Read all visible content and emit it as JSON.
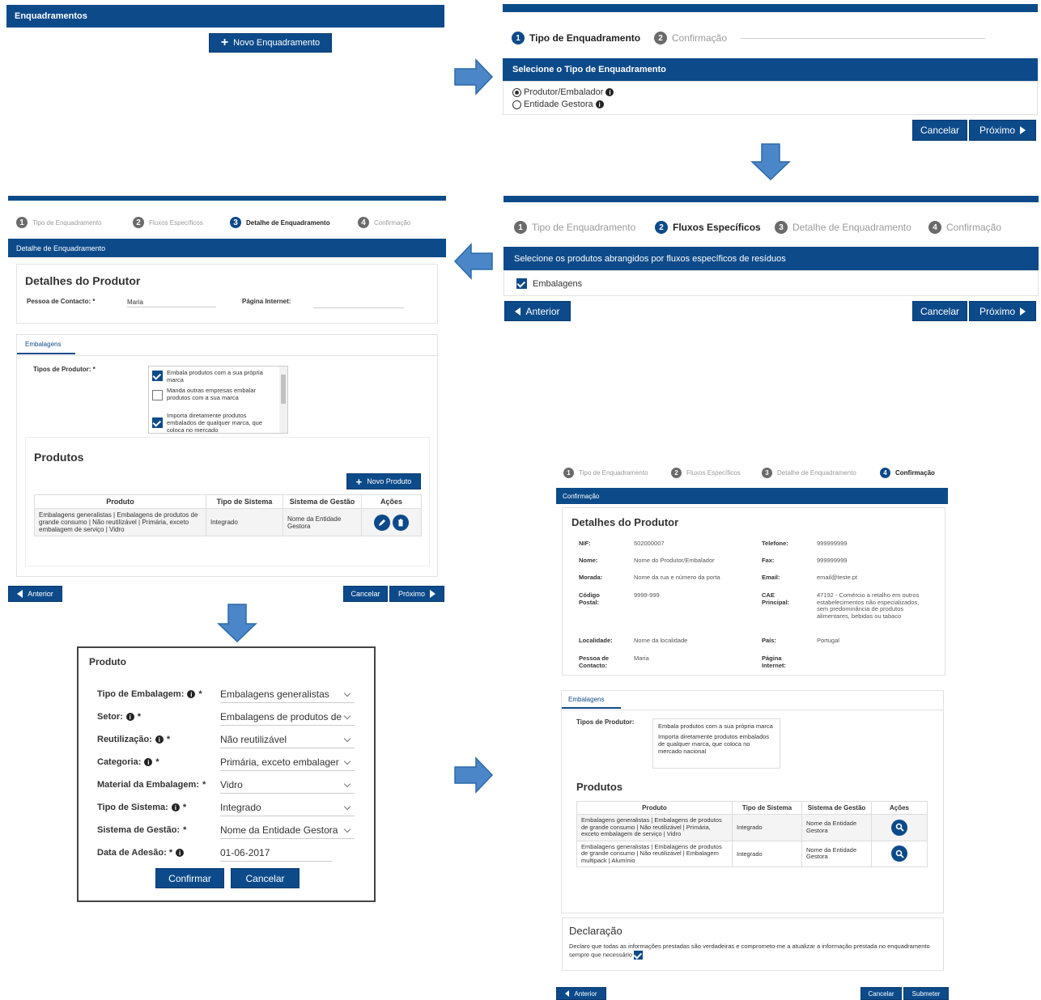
{
  "p1": {
    "header": "Enquadramentos",
    "new_btn": "Novo Enquadramento"
  },
  "p2": {
    "steps": [
      {
        "n": "1",
        "label": "Tipo de Enquadramento"
      },
      {
        "n": "2",
        "label": "Confirmação"
      }
    ],
    "section": "Selecione o Tipo de Enquadramento",
    "options": [
      "Produtor/Embalador",
      "Entidade Gestora"
    ],
    "cancel": "Cancelar",
    "next": "Próximo"
  },
  "p3": {
    "steps": [
      {
        "n": "1",
        "label": "Tipo de Enquadramento"
      },
      {
        "n": "2",
        "label": "Fluxos Específicos"
      },
      {
        "n": "3",
        "label": "Detalhe de Enquadramento"
      },
      {
        "n": "4",
        "label": "Confirmação"
      }
    ],
    "section": "Selecione os produtos abrangidos por fluxos específicos de resíduos",
    "checkbox": "Embalagens",
    "prev": "Anterior",
    "cancel": "Cancelar",
    "next": "Próximo"
  },
  "p4": {
    "steps": [
      {
        "n": "1",
        "label": "Tipo de Enquadramento"
      },
      {
        "n": "2",
        "label": "Fluxos Específicos"
      },
      {
        "n": "3",
        "label": "Detalhe de Enquadramento"
      },
      {
        "n": "4",
        "label": "Confirmação"
      }
    ],
    "section": "Detalhe de Enquadramento",
    "title": "Detalhes do Produtor",
    "contact_label": "Pessoa de Contacto: *",
    "contact_value": "Maria",
    "web_label": "Página Internet:",
    "tab": "Embalagens",
    "types_label": "Tipos de Produtor: *",
    "types": [
      {
        "text": "Embala produtos com a sua própria marca",
        "checked": true
      },
      {
        "text": "Manda outras empresas embalar produtos com a sua marca",
        "checked": false
      },
      {
        "text": "Importa diretamente produtos embalados de qualquer marca, que coloca no mercado",
        "checked": true
      }
    ],
    "products_title": "Produtos",
    "new_product": "Novo Produto",
    "table_headers": [
      "Produto",
      "Tipo de Sistema",
      "Sistema de Gestão",
      "Ações"
    ],
    "row": [
      "Embalagens generalistas | Embalagens de produtos de grande consumo | Não reutilizável | Primária, exceto embalagem de serviço | Vidro",
      "Integrado",
      "Nome da Entidade Gestora"
    ],
    "prev": "Anterior",
    "cancel": "Cancelar",
    "next": "Próximo"
  },
  "p5": {
    "title": "Produto",
    "fields": [
      {
        "label": "Tipo de Embalagem:",
        "info": true,
        "req": "*",
        "value": "Embalagens generalistas",
        "select": true
      },
      {
        "label": "Setor:",
        "info": true,
        "req": "*",
        "value": "Embalagens de produtos de",
        "select": true
      },
      {
        "label": "Reutilização:",
        "info": true,
        "req": "*",
        "value": "Não reutilizável",
        "select": true
      },
      {
        "label": "Categoria:",
        "info": true,
        "req": "*",
        "value": "Primária, exceto embalager",
        "select": true
      },
      {
        "label": "Material da Embalagem:",
        "info": false,
        "req": "*",
        "value": "Vidro",
        "select": true
      },
      {
        "label": "Tipo de Sistema:",
        "info": true,
        "req": "*",
        "value": "Integrado",
        "select": true
      },
      {
        "label": "Sistema de Gestão:",
        "info": false,
        "req": "*",
        "value": "Nome da Entidade Gestora",
        "select": true
      },
      {
        "label": "Data de Adesão: *",
        "info": true,
        "req": "",
        "value": "01-06-2017",
        "select": false
      }
    ],
    "confirm": "Confirmar",
    "cancel": "Cancelar"
  },
  "p6": {
    "steps": [
      {
        "n": "1",
        "label": "Tipo de Enquadramento"
      },
      {
        "n": "2",
        "label": "Fluxos Específicos"
      },
      {
        "n": "3",
        "label": "Detalhe de Enquadramento"
      },
      {
        "n": "4",
        "label": "Confirmação"
      }
    ],
    "section": "Confirmação",
    "title": "Detalhes do Produtor",
    "left": [
      {
        "k": "NIF:",
        "v": "502000007"
      },
      {
        "k": "Nome:",
        "v": "Nome do Produtor/Embalador"
      },
      {
        "k": "Morada:",
        "v": "Nome da rua e número da porta"
      },
      {
        "k": "Código Postal:",
        "v": "9999-999"
      },
      {
        "k": "Localidade:",
        "v": "Nome da localidade"
      },
      {
        "k": "Pessoa de Contacto:",
        "v": "Maria"
      }
    ],
    "right": [
      {
        "k": "Telefone:",
        "v": "999999999"
      },
      {
        "k": "Fax:",
        "v": "999999999"
      },
      {
        "k": "Email:",
        "v": "email@teste.pt"
      },
      {
        "k": "CAE Principal:",
        "v": "47192 - Comércio a retalho em outros estabelecimentos não especializados, sem predominância de produtos alimentares, bebidas ou tabaco"
      },
      {
        "k": "País:",
        "v": "Portugal"
      },
      {
        "k": "Página Internet:",
        "v": ""
      }
    ],
    "tab": "Embalagens",
    "types_label": "Tipos de Produtor:",
    "types": [
      "Embala produtos com a sua própria marca",
      "Importa diretamente produtos embalados de qualquer marca, que coloca no mercado nacional"
    ],
    "products_title": "Produtos",
    "table_headers": [
      "Produto",
      "Tipo de Sistema",
      "Sistema de Gestão",
      "Ações"
    ],
    "rows": [
      [
        "Embalagens generalistas | Embalagens de produtos de grande consumo | Não reutilizável | Primária, exceto embalagem de serviço | Vidro",
        "Integrado",
        "Nome da Entidade Gestora"
      ],
      [
        "Embalagens generalistas | Embalagens de produtos de grande consumo | Não reutilizável | Embalagem multipack | Alumínio",
        "Integrado",
        "Nome da Entidade Gestora"
      ]
    ],
    "decl_title": "Declaração",
    "decl_text": "Declaro que todas as informações prestadas são verdadeiras e comprometo-me a atualizar a informação prestada no enquadramento sempre que necessário",
    "prev": "Anterior",
    "cancel": "Cancelar",
    "submit": "Submeter"
  }
}
